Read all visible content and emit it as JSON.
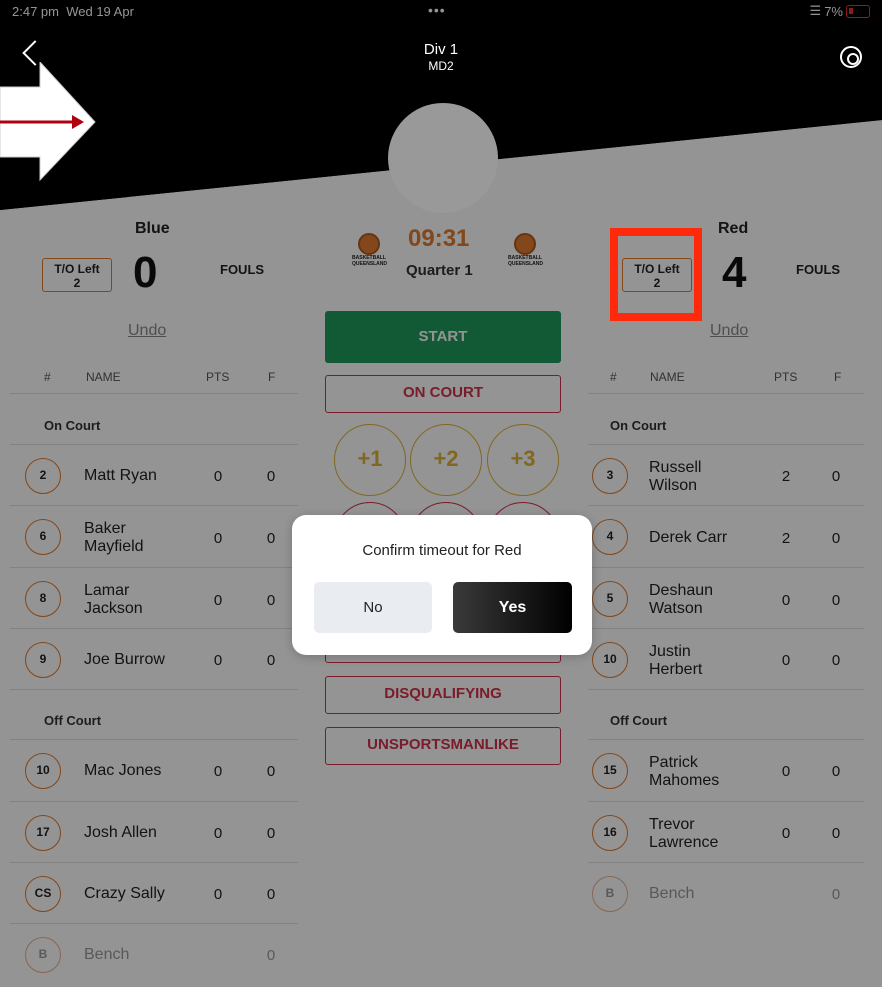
{
  "status_bar": {
    "time": "2:47 pm",
    "date": "Wed 19 Apr",
    "dots": "•••",
    "battery": "7%",
    "wifi_icon": "wifi-icon"
  },
  "header": {
    "title": "Div 1",
    "subtitle": "MD2"
  },
  "blue": {
    "name": "Blue",
    "to_label": "T/O Left",
    "to_value": "2",
    "score": "0",
    "fouls_label": "FOULS",
    "undo": "Undo",
    "columns": {
      "num": "#",
      "name": "NAME",
      "pts": "PTS",
      "f": "F"
    },
    "on_court_label": "On Court",
    "off_court_label": "Off Court",
    "on_court": [
      {
        "num": "2",
        "name": "Matt Ryan",
        "pts": "0",
        "f": "0"
      },
      {
        "num": "6",
        "name": "Baker Mayfield",
        "pts": "0",
        "f": "0"
      },
      {
        "num": "8",
        "name": "Lamar Jackson",
        "pts": "0",
        "f": "0"
      },
      {
        "num": "9",
        "name": "Joe Burrow",
        "pts": "0",
        "f": "0"
      }
    ],
    "off_court": [
      {
        "num": "10",
        "name": "Mac Jones",
        "pts": "0",
        "f": "0"
      },
      {
        "num": "17",
        "name": "Josh Allen",
        "pts": "0",
        "f": "0"
      },
      {
        "num": "CS",
        "name": "Crazy Sally",
        "pts": "0",
        "f": "0"
      }
    ],
    "bench": {
      "num": "B",
      "name": "Bench",
      "f": "0"
    }
  },
  "red": {
    "name": "Red",
    "to_label": "T/O Left",
    "to_value": "2",
    "score": "4",
    "fouls_label": "FOULS",
    "undo": "Undo",
    "columns": {
      "num": "#",
      "name": "NAME",
      "pts": "PTS",
      "f": "F"
    },
    "on_court_label": "On Court",
    "off_court_label": "Off Court",
    "on_court": [
      {
        "num": "3",
        "name": "Russell Wilson",
        "pts": "2",
        "f": "0"
      },
      {
        "num": "4",
        "name": "Derek Carr",
        "pts": "2",
        "f": "0"
      },
      {
        "num": "5",
        "name": "Deshaun Watson",
        "pts": "0",
        "f": "0"
      },
      {
        "num": "10",
        "name": "Justin Herbert",
        "pts": "0",
        "f": "0"
      }
    ],
    "off_court": [
      {
        "num": "15",
        "name": "Patrick Mahomes",
        "pts": "0",
        "f": "0"
      },
      {
        "num": "16",
        "name": "Trevor Lawrence",
        "pts": "0",
        "f": "0"
      }
    ],
    "bench": {
      "num": "B",
      "name": "Bench",
      "f": "0"
    }
  },
  "center": {
    "clock": "09:31",
    "quarter": "Quarter 1",
    "logo_caption": "BASKETBALL QUEENSLAND",
    "start": "START",
    "on_court": "ON COURT",
    "plus1": "+1",
    "plus2": "+2",
    "plus3": "+3",
    "disqualifying": "DISQUALIFYING",
    "unsportsmanlike": "UNSPORTSMANLIKE"
  },
  "modal": {
    "title": "Confirm timeout for Red",
    "no": "No",
    "yes": "Yes"
  },
  "colors": {
    "accent_orange": "#e07a2e",
    "start_green": "#1f9a5d",
    "foul_red": "#d1314a",
    "highlight": "#ff2a0c"
  }
}
